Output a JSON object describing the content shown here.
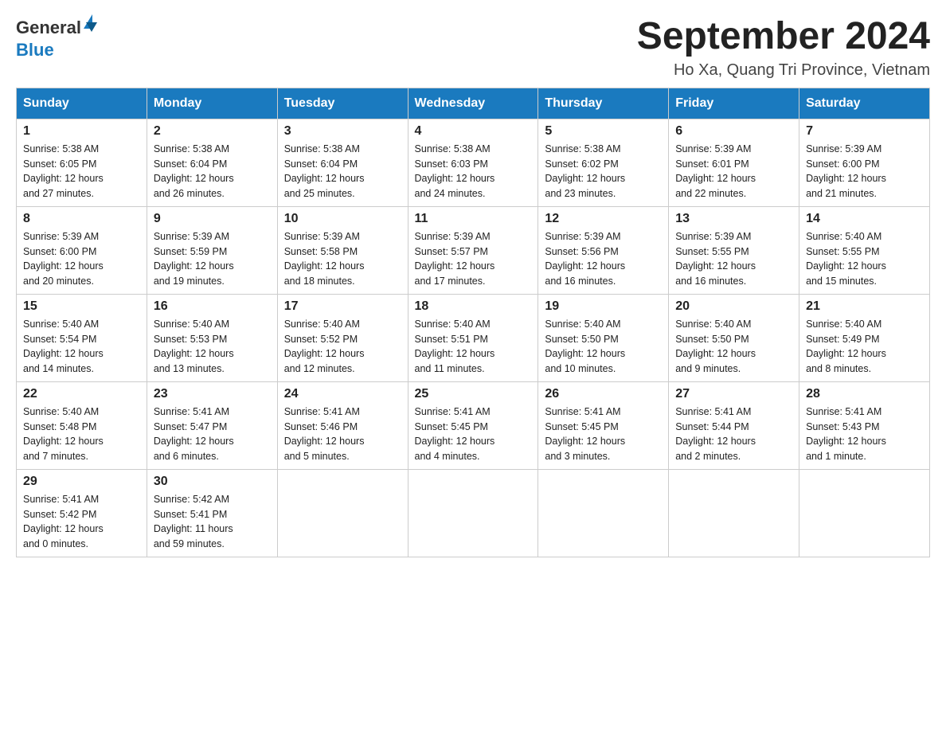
{
  "header": {
    "logo": {
      "text_general": "General",
      "text_blue": "Blue"
    },
    "title": "September 2024",
    "subtitle": "Ho Xa, Quang Tri Province, Vietnam"
  },
  "calendar": {
    "weekdays": [
      "Sunday",
      "Monday",
      "Tuesday",
      "Wednesday",
      "Thursday",
      "Friday",
      "Saturday"
    ],
    "weeks": [
      [
        {
          "day": "1",
          "sunrise": "5:38 AM",
          "sunset": "6:05 PM",
          "daylight": "12 hours and 27 minutes."
        },
        {
          "day": "2",
          "sunrise": "5:38 AM",
          "sunset": "6:04 PM",
          "daylight": "12 hours and 26 minutes."
        },
        {
          "day": "3",
          "sunrise": "5:38 AM",
          "sunset": "6:04 PM",
          "daylight": "12 hours and 25 minutes."
        },
        {
          "day": "4",
          "sunrise": "5:38 AM",
          "sunset": "6:03 PM",
          "daylight": "12 hours and 24 minutes."
        },
        {
          "day": "5",
          "sunrise": "5:38 AM",
          "sunset": "6:02 PM",
          "daylight": "12 hours and 23 minutes."
        },
        {
          "day": "6",
          "sunrise": "5:39 AM",
          "sunset": "6:01 PM",
          "daylight": "12 hours and 22 minutes."
        },
        {
          "day": "7",
          "sunrise": "5:39 AM",
          "sunset": "6:00 PM",
          "daylight": "12 hours and 21 minutes."
        }
      ],
      [
        {
          "day": "8",
          "sunrise": "5:39 AM",
          "sunset": "6:00 PM",
          "daylight": "12 hours and 20 minutes."
        },
        {
          "day": "9",
          "sunrise": "5:39 AM",
          "sunset": "5:59 PM",
          "daylight": "12 hours and 19 minutes."
        },
        {
          "day": "10",
          "sunrise": "5:39 AM",
          "sunset": "5:58 PM",
          "daylight": "12 hours and 18 minutes."
        },
        {
          "day": "11",
          "sunrise": "5:39 AM",
          "sunset": "5:57 PM",
          "daylight": "12 hours and 17 minutes."
        },
        {
          "day": "12",
          "sunrise": "5:39 AM",
          "sunset": "5:56 PM",
          "daylight": "12 hours and 16 minutes."
        },
        {
          "day": "13",
          "sunrise": "5:39 AM",
          "sunset": "5:55 PM",
          "daylight": "12 hours and 16 minutes."
        },
        {
          "day": "14",
          "sunrise": "5:40 AM",
          "sunset": "5:55 PM",
          "daylight": "12 hours and 15 minutes."
        }
      ],
      [
        {
          "day": "15",
          "sunrise": "5:40 AM",
          "sunset": "5:54 PM",
          "daylight": "12 hours and 14 minutes."
        },
        {
          "day": "16",
          "sunrise": "5:40 AM",
          "sunset": "5:53 PM",
          "daylight": "12 hours and 13 minutes."
        },
        {
          "day": "17",
          "sunrise": "5:40 AM",
          "sunset": "5:52 PM",
          "daylight": "12 hours and 12 minutes."
        },
        {
          "day": "18",
          "sunrise": "5:40 AM",
          "sunset": "5:51 PM",
          "daylight": "12 hours and 11 minutes."
        },
        {
          "day": "19",
          "sunrise": "5:40 AM",
          "sunset": "5:50 PM",
          "daylight": "12 hours and 10 minutes."
        },
        {
          "day": "20",
          "sunrise": "5:40 AM",
          "sunset": "5:50 PM",
          "daylight": "12 hours and 9 minutes."
        },
        {
          "day": "21",
          "sunrise": "5:40 AM",
          "sunset": "5:49 PM",
          "daylight": "12 hours and 8 minutes."
        }
      ],
      [
        {
          "day": "22",
          "sunrise": "5:40 AM",
          "sunset": "5:48 PM",
          "daylight": "12 hours and 7 minutes."
        },
        {
          "day": "23",
          "sunrise": "5:41 AM",
          "sunset": "5:47 PM",
          "daylight": "12 hours and 6 minutes."
        },
        {
          "day": "24",
          "sunrise": "5:41 AM",
          "sunset": "5:46 PM",
          "daylight": "12 hours and 5 minutes."
        },
        {
          "day": "25",
          "sunrise": "5:41 AM",
          "sunset": "5:45 PM",
          "daylight": "12 hours and 4 minutes."
        },
        {
          "day": "26",
          "sunrise": "5:41 AM",
          "sunset": "5:45 PM",
          "daylight": "12 hours and 3 minutes."
        },
        {
          "day": "27",
          "sunrise": "5:41 AM",
          "sunset": "5:44 PM",
          "daylight": "12 hours and 2 minutes."
        },
        {
          "day": "28",
          "sunrise": "5:41 AM",
          "sunset": "5:43 PM",
          "daylight": "12 hours and 1 minute."
        }
      ],
      [
        {
          "day": "29",
          "sunrise": "5:41 AM",
          "sunset": "5:42 PM",
          "daylight": "12 hours and 0 minutes."
        },
        {
          "day": "30",
          "sunrise": "5:42 AM",
          "sunset": "5:41 PM",
          "daylight": "11 hours and 59 minutes."
        },
        null,
        null,
        null,
        null,
        null
      ]
    ],
    "labels": {
      "sunrise": "Sunrise:",
      "sunset": "Sunset:",
      "daylight": "Daylight:"
    }
  }
}
